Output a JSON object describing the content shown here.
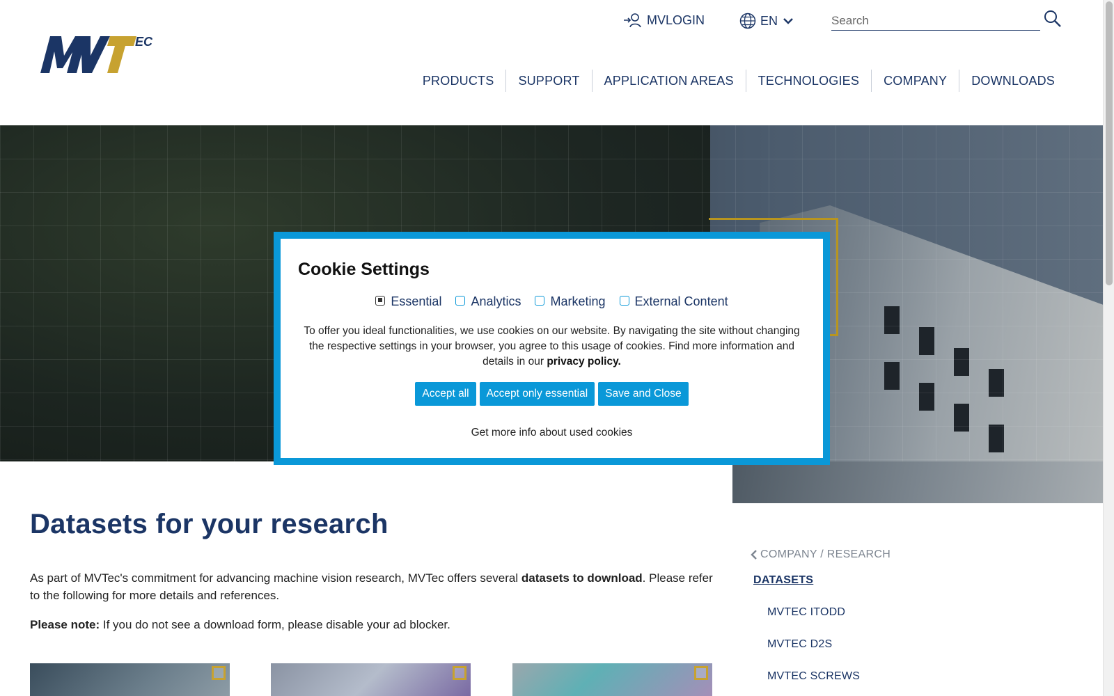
{
  "header": {
    "logo_text": "MVTec",
    "login_label": "MVLOGIN",
    "language": "EN",
    "search_placeholder": "Search",
    "nav": [
      "PRODUCTS",
      "SUPPORT",
      "APPLICATION AREAS",
      "TECHNOLOGIES",
      "COMPANY",
      "DOWNLOADS"
    ]
  },
  "main": {
    "title": "Datasets for your research",
    "intro_before": "As part of MVTec's commitment for advancing machine vision research, MVTec offers several ",
    "intro_bold": "datasets to download",
    "intro_after": ". Please refer to the following for more details and references.",
    "note_bold": "Please note:",
    "note_text": " If you do not see a download form, please disable your ad blocker."
  },
  "sidenav": {
    "breadcrumb": "COMPANY / RESEARCH",
    "active": "DATASETS",
    "items": [
      "MVTEC ITODD",
      "MVTEC D2S",
      "MVTEC SCREWS"
    ]
  },
  "cookie": {
    "title": "Cookie Settings",
    "options": [
      {
        "label": "Essential",
        "checked": true
      },
      {
        "label": "Analytics",
        "checked": false
      },
      {
        "label": "Marketing",
        "checked": false
      },
      {
        "label": "External Content",
        "checked": false
      }
    ],
    "text": "To offer you ideal functionalities, we use cookies on our website. By navigating the site without changing the respective settings in your browser, you agree to this usage of cookies. Find more information and details in our ",
    "privacy_link": "privacy policy.",
    "buttons": {
      "accept_all": "Accept all",
      "accept_essential": "Accept only essential",
      "save_close": "Save and Close"
    },
    "more_info": "Get more info about used cookies"
  },
  "colors": {
    "brand_navy": "#1b3565",
    "accent_blue": "#0a98d8",
    "logo_gold": "#c7a230"
  }
}
